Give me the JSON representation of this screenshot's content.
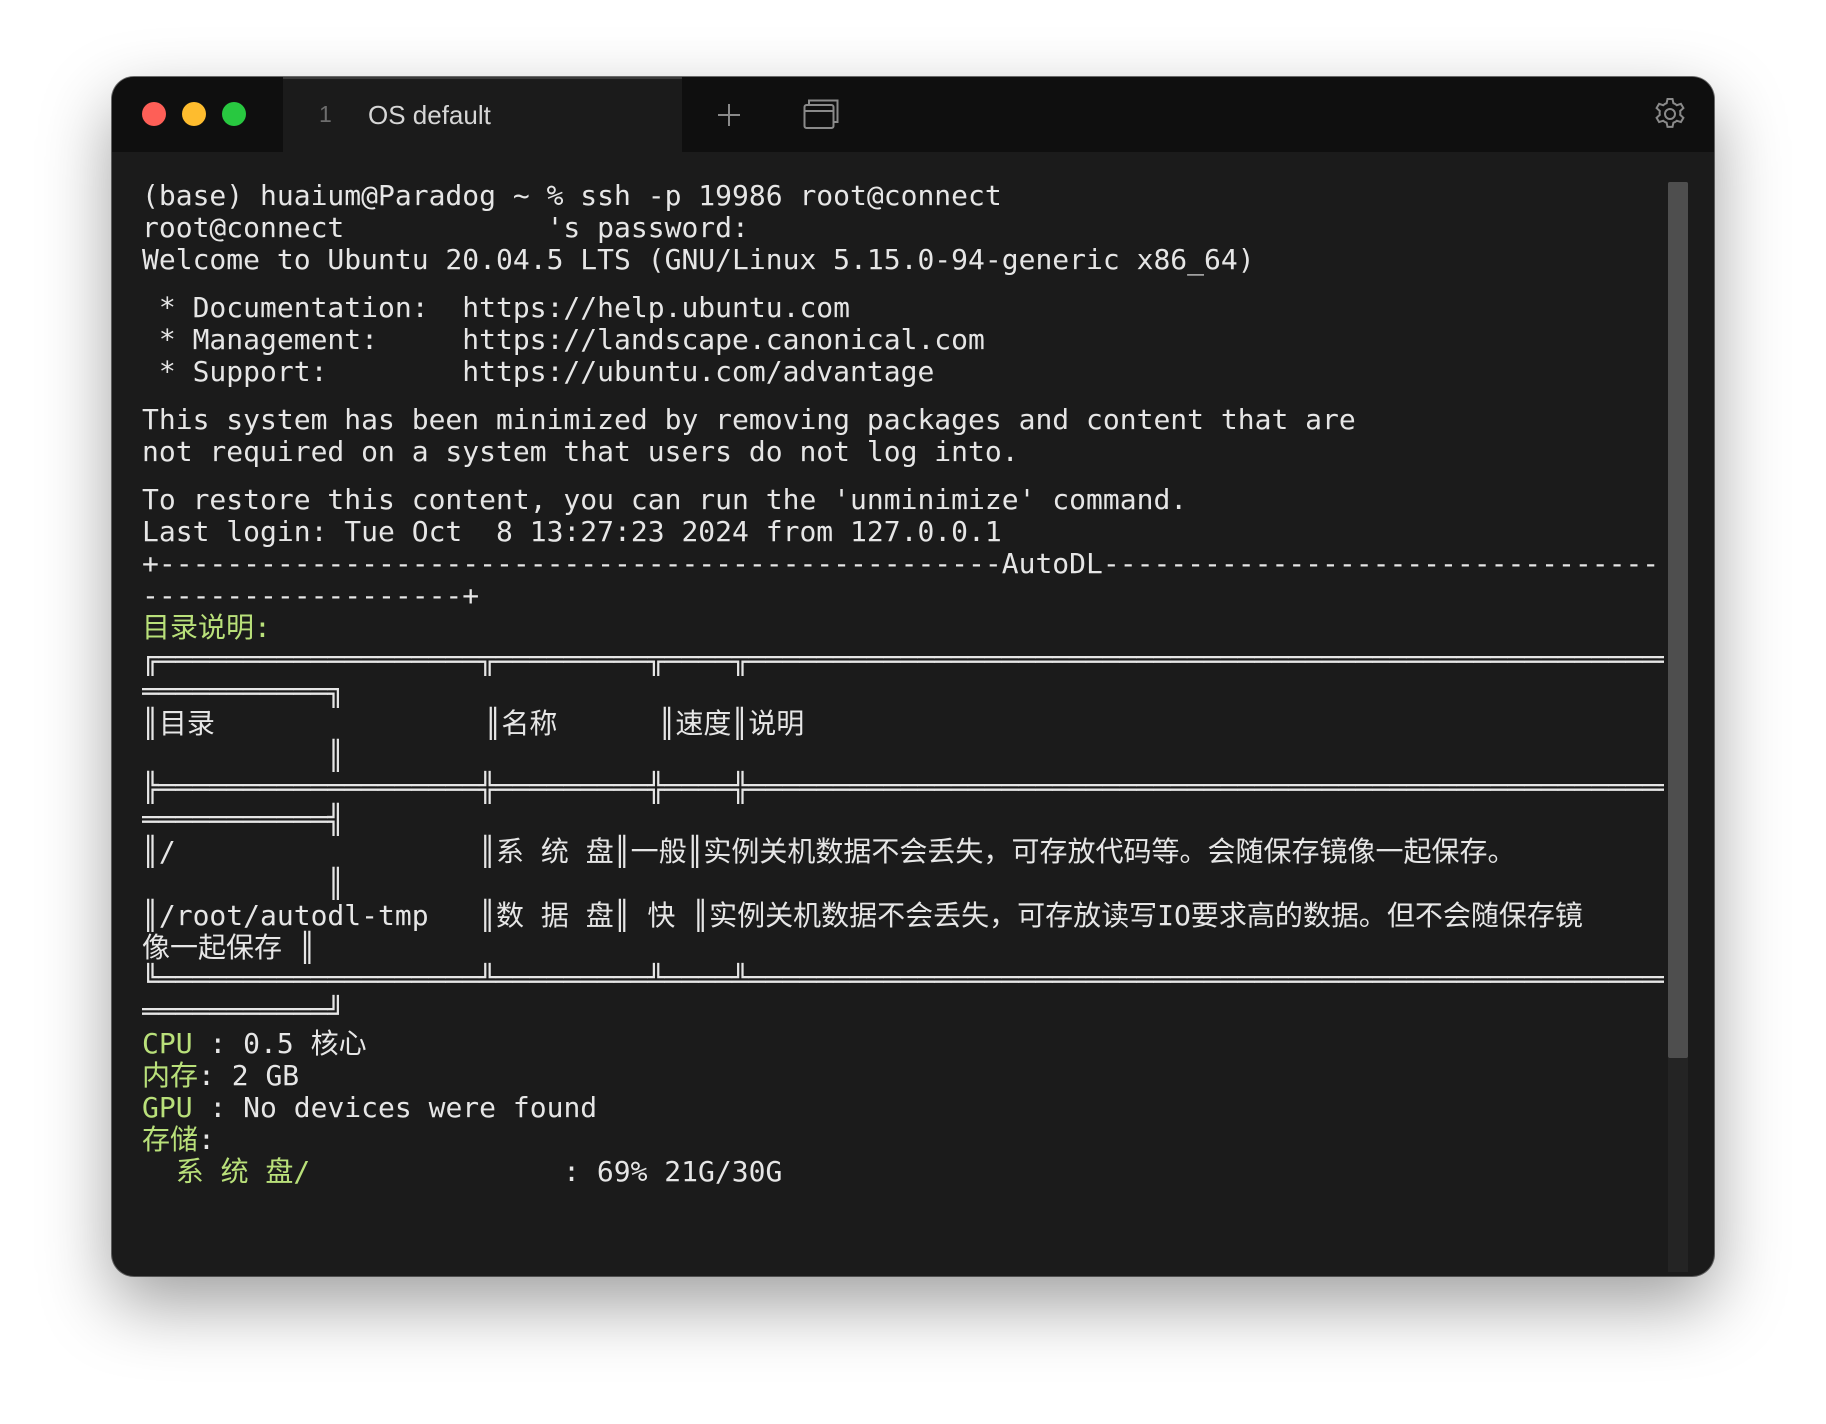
{
  "tab": {
    "index": "1",
    "title": "OS default"
  },
  "toolbar": {
    "new_tab_icon": "plus-icon",
    "window_icon": "window-stack-icon",
    "settings_icon": "gear-icon"
  },
  "colors": {
    "background": "#1b1b1b",
    "titlebar": "#0f0f0f",
    "text": "#e6e6e6",
    "green_text": "#b9e07a",
    "close": "#fe5f57",
    "minimize": "#febc2e",
    "maximize": "#28c840"
  },
  "terminal": {
    "prompt_line": "(base) huaium@Paradog ~ % ssh -p 19986 root@connect",
    "password_line": "root@connect            's password:",
    "welcome_line": "Welcome to Ubuntu 20.04.5 LTS (GNU/Linux 5.15.0-94-generic x86_64)",
    "doc_line": " * Documentation:  https://help.ubuntu.com",
    "mgmt_line": " * Management:     https://landscape.canonical.com",
    "support_line": " * Support:        https://ubuntu.com/advantage",
    "minimized_line1": "This system has been minimized by removing packages and content that are",
    "minimized_line2": "not required on a system that users do not log into.",
    "restore_line": "To restore this content, you can run the 'unminimize' command.",
    "last_login_line": "Last login: Tue Oct  8 13:27:23 2024 from 127.0.0.1",
    "autodl_sep_line1": "+--------------------------------------------------AutoDL-------------------------------------------------",
    "autodl_sep_line2": "-------------------+",
    "dir_heading": "目录说明:",
    "table_top": "╔═══════════════════╦═════════╦════╦═════════════════════════════════════════════════════════════════════",
    "table_top_cont": "═══════════╗",
    "header_row": "║目录                ║名称      ║速度║说明",
    "header_row_cont": "           ║",
    "table_mid": "╠═══════════════════╬═════════╬════╬═════════════════════════════════════════════════════════════════════",
    "table_mid_cont": "═══════════╣",
    "row1": "║/                  ║系 统 盘║一般║实例关机数据不会丢失，可存放代码等。会随保存镜像一起保存。",
    "row1_cont": "           ║",
    "row2": "║/root/autodl-tmp   ║数 据 盘║ 快 ║实例关机数据不会丢失，可存放读写IO要求高的数据。但不会随保存镜",
    "row2_cont": "像一起保存 ║",
    "table_bottom": "╚═══════════════════╩═════════╩════╩═════════════════════════════════════════════════════════════════════",
    "table_bottom_cont": "═══════════╝",
    "cpu_label": "CPU",
    "cpu_value": " : 0.5 核心",
    "mem_label": "内存",
    "mem_value": ": 2 GB",
    "gpu_label": "GPU",
    "gpu_value": " : No devices were found",
    "storage_label": "存储",
    "storage_colon": ":",
    "sysdisk_label": "  系 统 盘/",
    "sysdisk_value": "               : 69% 21G/30G"
  }
}
